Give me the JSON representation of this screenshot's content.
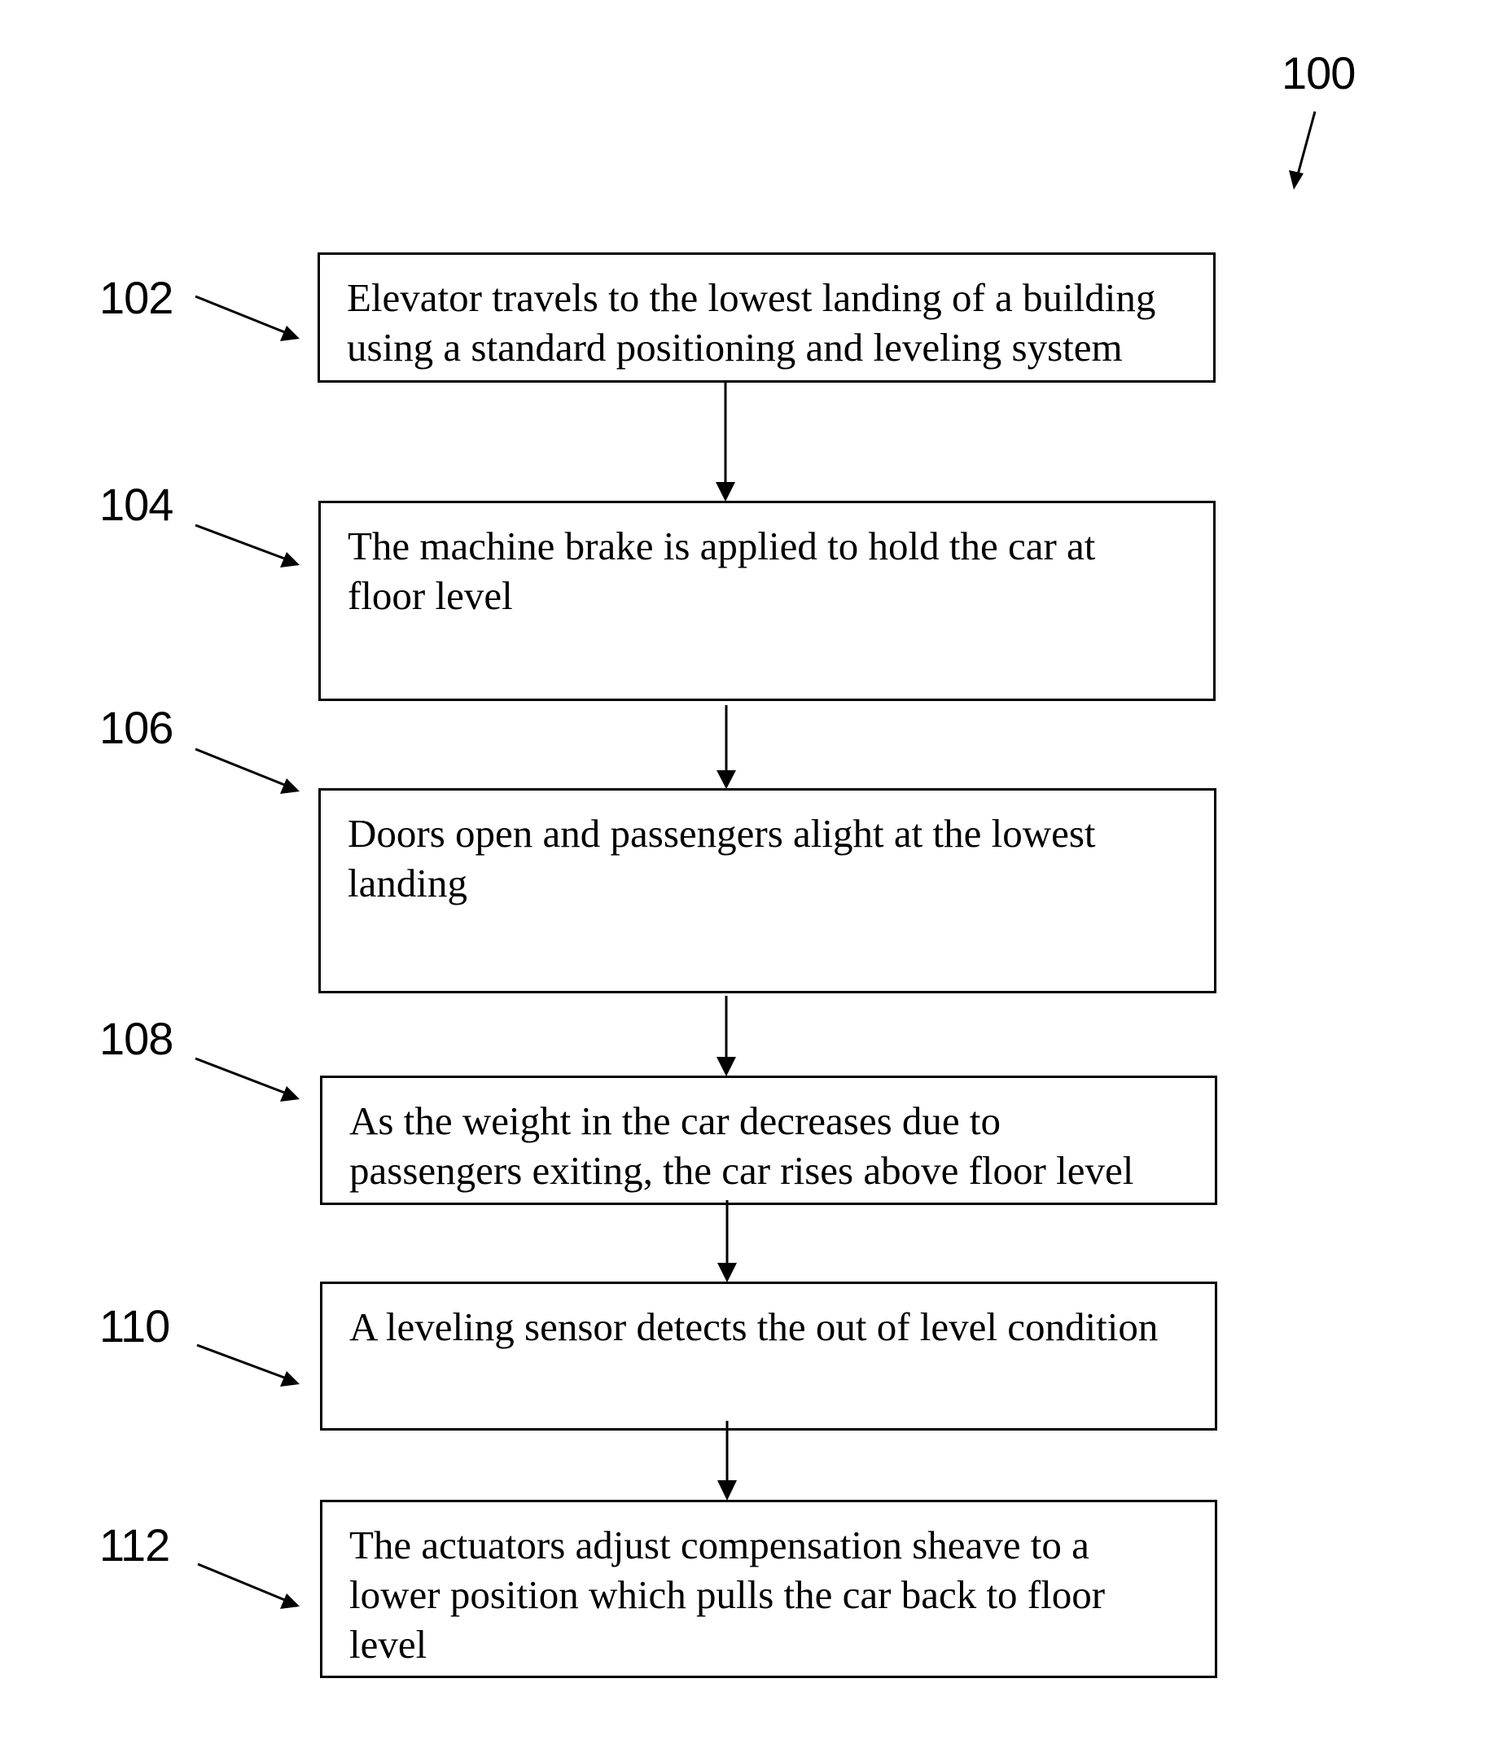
{
  "figure": {
    "reference": "100",
    "steps": [
      {
        "ref": "102",
        "text": "Elevator travels to the lowest landing of a building\nusing a standard positioning and leveling system"
      },
      {
        "ref": "104",
        "text": "The machine brake is applied to hold the car at\nfloor level"
      },
      {
        "ref": "106",
        "text": "Doors open and passengers alight at the lowest\nlanding"
      },
      {
        "ref": "108",
        "text": "As the weight in the car decreases due to\npassengers exiting, the car rises above floor level"
      },
      {
        "ref": "110",
        "text": "A leveling sensor detects the out of level condition"
      },
      {
        "ref": "112",
        "text": "The actuators adjust compensation sheave to a\nlower position which pulls the car back to floor\nlevel"
      }
    ]
  },
  "colors": {
    "ink": "#000000",
    "background": "#ffffff"
  }
}
